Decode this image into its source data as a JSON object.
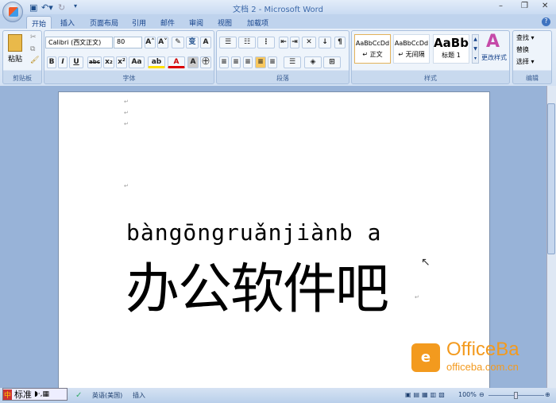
{
  "title": "文档 2 - Microsoft Word",
  "tabs": [
    "开始",
    "插入",
    "页面布局",
    "引用",
    "邮件",
    "审阅",
    "视图",
    "加载项"
  ],
  "clipboard": {
    "paste": "粘贴",
    "label": "剪贴板"
  },
  "font": {
    "name": "Calibri (西文正文)",
    "size": "80",
    "label": "字体",
    "bold": "B",
    "italic": "I",
    "underline": "U",
    "strike": "abc",
    "sub": "x₂",
    "sup": "x²",
    "case": "Aa",
    "grow": "A˄",
    "shrink": "A˅",
    "color": "A",
    "char_border": "A",
    "enclose": "㊉"
  },
  "paragraph": {
    "label": "段落"
  },
  "styles": {
    "label": "样式",
    "items": [
      {
        "preview": "AaBbCcDd",
        "name": "↵ 正文"
      },
      {
        "preview": "AaBbCcDd",
        "name": "↵ 无间隔"
      },
      {
        "preview": "AaBb",
        "name": "标题 1"
      }
    ],
    "change": "更改样式"
  },
  "editing": {
    "label": "编辑",
    "find": "查找 ▾",
    "replace": "替换",
    "select": "选择 ▾"
  },
  "document": {
    "pinyin": "bàngōngruǎnjiànb a",
    "text": "办公软件吧"
  },
  "watermark": {
    "brand": "OfficeBa",
    "url": "officeba.com.cn"
  },
  "ime": {
    "mode": "标准"
  },
  "status": {
    "language": "英语(美国)",
    "mode": "插入",
    "zoom": "100%"
  }
}
